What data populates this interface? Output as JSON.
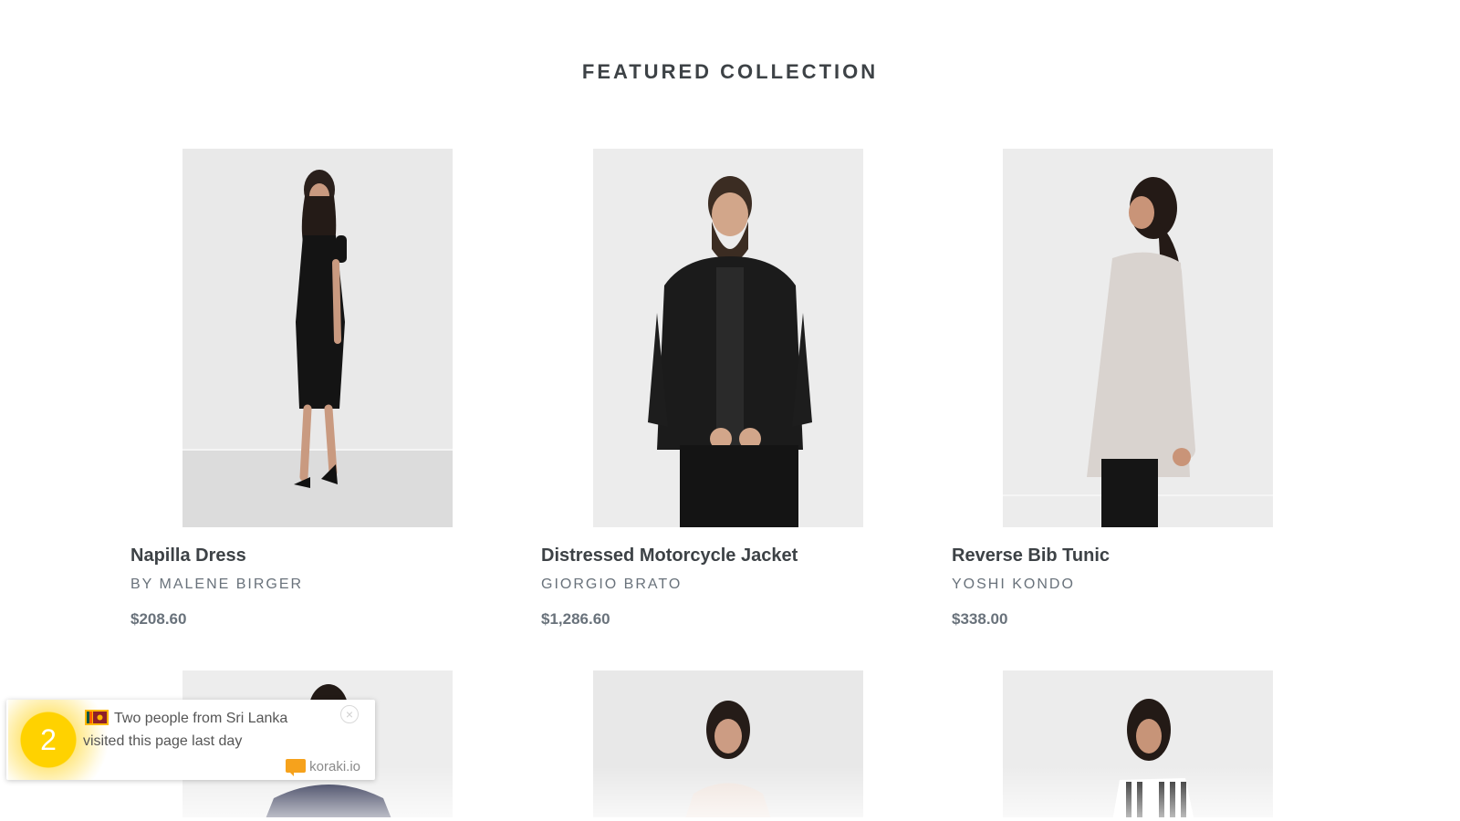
{
  "section": {
    "title": "FEATURED COLLECTION"
  },
  "products": [
    {
      "title": "Napilla Dress",
      "vendor": "BY MALENE BIRGER",
      "price": "$208.60"
    },
    {
      "title": "Distressed Motorcycle Jacket",
      "vendor": "GIORGIO BRATO",
      "price": "$1,286.60"
    },
    {
      "title": "Reverse Bib Tunic",
      "vendor": "YOSHI KONDO",
      "price": "$338.00"
    }
  ],
  "popup": {
    "count": "2",
    "message": "Two people from Sri Lanka visited this page last day",
    "close_label": "×",
    "brand": "koraki.io",
    "flag_icon": "sri-lanka-flag-icon",
    "accent_color": "#ffd200"
  }
}
